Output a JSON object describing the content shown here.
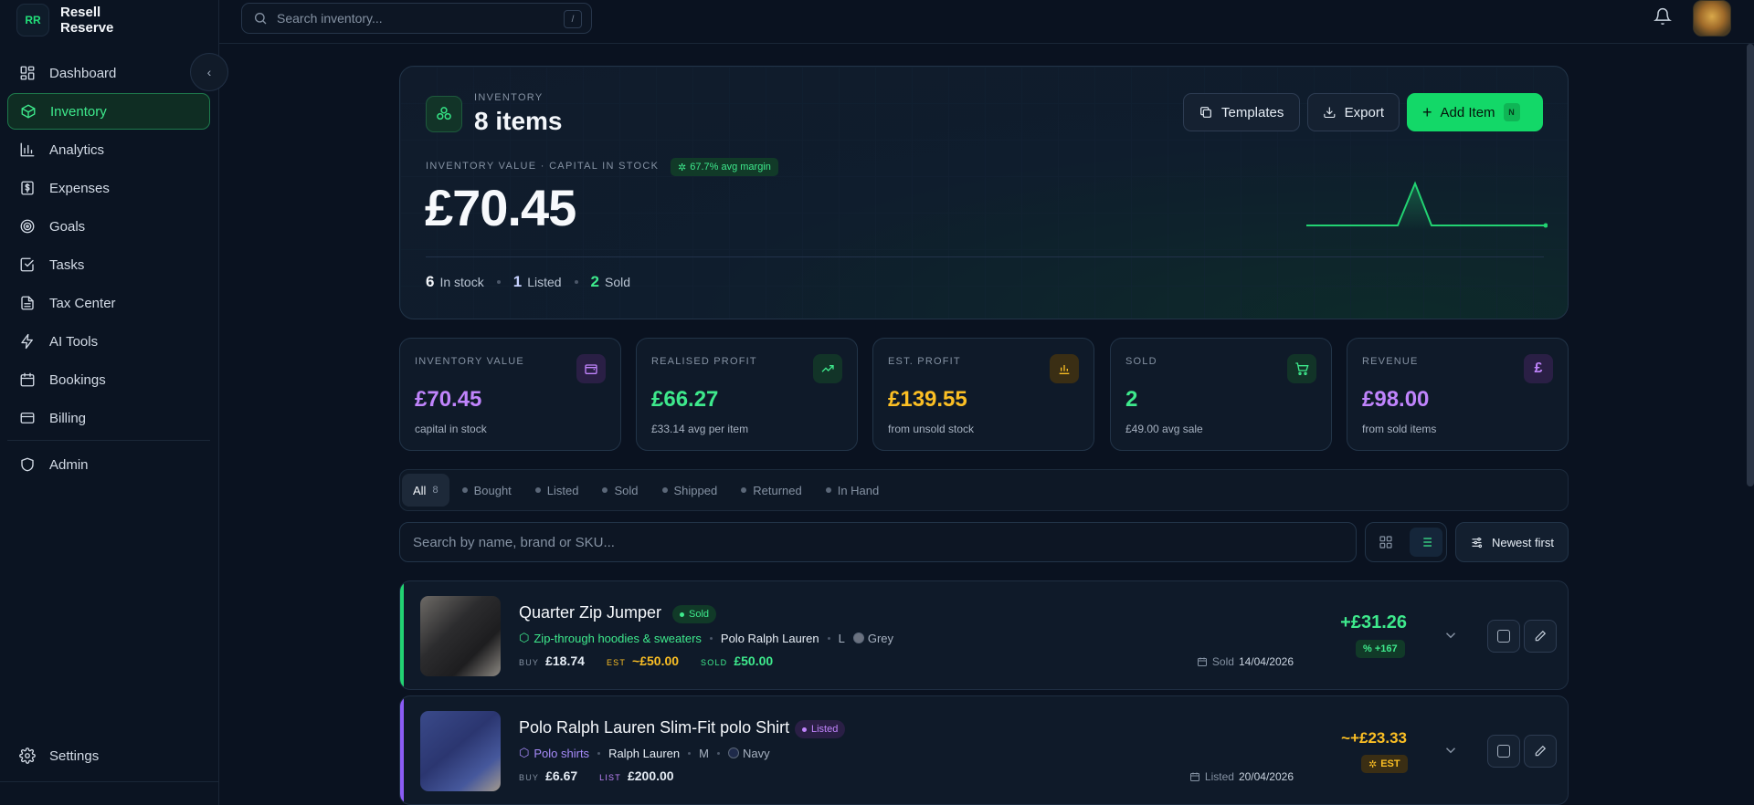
{
  "brand": {
    "logo": "RR",
    "name": "Resell Reserve"
  },
  "topbar": {
    "search_placeholder": "Search inventory...",
    "shortcut": "/"
  },
  "sidebar": {
    "items": [
      {
        "label": "Dashboard",
        "icon": "dashboard-icon"
      },
      {
        "label": "Inventory",
        "icon": "box-icon",
        "active": true
      },
      {
        "label": "Analytics",
        "icon": "bar-chart-icon"
      },
      {
        "label": "Expenses",
        "icon": "dollar-receipt-icon"
      },
      {
        "label": "Goals",
        "icon": "target-icon"
      },
      {
        "label": "Tasks",
        "icon": "checkbox-icon"
      },
      {
        "label": "Tax Center",
        "icon": "document-icon"
      },
      {
        "label": "AI Tools",
        "icon": "lightning-icon"
      },
      {
        "label": "Bookings",
        "icon": "calendar-icon"
      },
      {
        "label": "Billing",
        "icon": "credit-card-icon"
      },
      {
        "label": "Admin",
        "icon": "shield-icon"
      }
    ],
    "settings_label": "Settings"
  },
  "hero": {
    "label": "INVENTORY",
    "count": "8 items",
    "templates_label": "Templates",
    "export_label": "Export",
    "add_label": "Add Item",
    "add_key": "N",
    "value_label": "INVENTORY VALUE · CAPITAL IN STOCK",
    "margin_badge": "67.7% avg margin",
    "value": "£70.45",
    "stats": [
      {
        "n": "6",
        "label": "In stock"
      },
      {
        "n": "1",
        "label": "Listed"
      },
      {
        "n": "2",
        "label": "Sold"
      }
    ]
  },
  "kpis": [
    {
      "label": "INVENTORY VALUE",
      "value": "£70.45",
      "sub": "capital in stock",
      "color": "#c084fc",
      "icon": "wallet-icon"
    },
    {
      "label": "REALISED PROFIT",
      "value": "£66.27",
      "sub": "£33.14 avg per item",
      "color": "#3ee98c",
      "icon": "trending-up-icon"
    },
    {
      "label": "EST. PROFIT",
      "value": "£139.55",
      "sub": "from unsold stock",
      "color": "#fbbf24",
      "icon": "bar-chart-icon"
    },
    {
      "label": "SOLD",
      "value": "2",
      "sub": "£49.00 avg sale",
      "color": "#3ee98c",
      "icon": "cart-icon"
    },
    {
      "label": "REVENUE",
      "value": "£98.00",
      "sub": "from sold items",
      "color": "#c084fc",
      "icon": "pound-icon"
    }
  ],
  "tabs": [
    {
      "label": "All",
      "count": "8",
      "active": true
    },
    {
      "label": "Bought"
    },
    {
      "label": "Listed"
    },
    {
      "label": "Sold"
    },
    {
      "label": "Shipped"
    },
    {
      "label": "Returned"
    },
    {
      "label": "In Hand"
    }
  ],
  "list": {
    "search_placeholder": "Search by name, brand or SKU...",
    "sort_label": "Newest first"
  },
  "items": [
    {
      "title": "Quarter Zip Jumper",
      "status": "Sold",
      "category": "Zip-through hoodies & sweaters",
      "brand": "Polo Ralph Lauren",
      "size": "L",
      "colour": "Grey",
      "buy_label": "BUY",
      "buy": "£18.74",
      "est_label": "EST",
      "est": "~£50.00",
      "third_label": "SOLD",
      "third": "£50.00",
      "date_label": "Sold",
      "date": "14/04/2026",
      "profit": "+£31.26",
      "pill": "% +167"
    },
    {
      "title": "Polo Ralph Lauren Slim-Fit polo Shirt",
      "status": "Listed",
      "category": "Polo shirts",
      "brand": "Ralph Lauren",
      "size": "M",
      "colour": "Navy",
      "buy_label": "BUY",
      "buy": "£6.67",
      "third_label": "LIST",
      "third": "£200.00",
      "date_label": "Listed",
      "date": "20/04/2026",
      "profit": "~+£23.33",
      "pill": "EST"
    }
  ],
  "colors": {
    "accent": "#13d868",
    "purple": "#c084fc",
    "amber": "#fbbf24",
    "bg": "#0a1220"
  }
}
